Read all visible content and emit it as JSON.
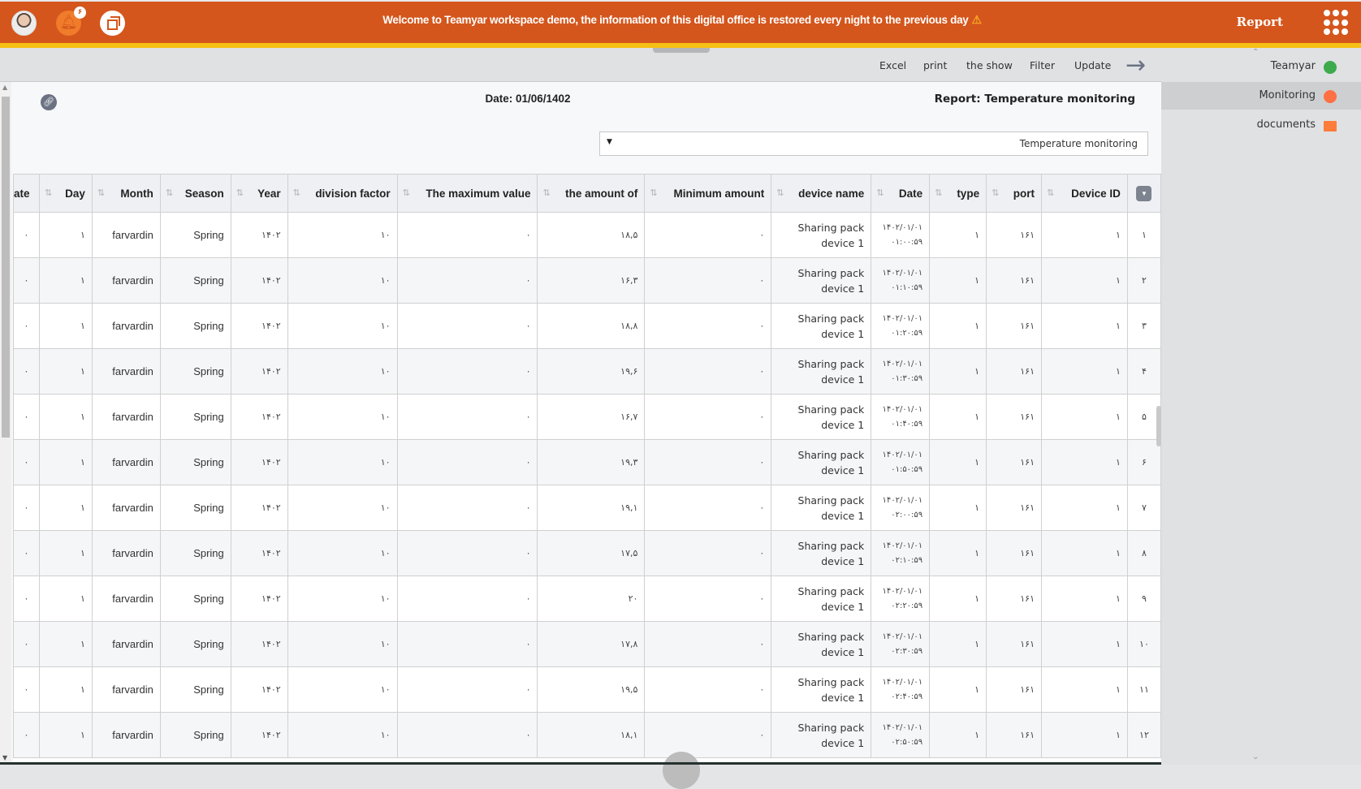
{
  "header": {
    "banner": "Welcome to Teamyar workspace demo, the information of this digital office is restored every night to the previous day",
    "notification_count": "۶",
    "title": "Report",
    "icons": [
      "avatar",
      "bell-icon",
      "window-icon",
      "warning-icon",
      "apps-grid-icon"
    ]
  },
  "toolbar": {
    "excel": "Excel",
    "print": "print",
    "show": "the show",
    "filter": "Filter",
    "update": "Update",
    "back_icon": "arrow-right-icon"
  },
  "report": {
    "date_label": "Date: 01/06/1402",
    "report_label": "Report: Temperature monitoring",
    "select_value": "Temperature monitoring"
  },
  "table": {
    "columns": [
      "ate",
      "Day",
      "Month",
      "Season",
      "Year",
      "division factor",
      "The maximum value",
      "the amount of",
      "Minimum amount",
      "device name",
      "Date",
      "type",
      "port",
      "Device ID"
    ],
    "rows": [
      {
        "rn": "۱",
        "ate": "۰",
        "day": "۱",
        "month": "farvardin",
        "season": "Spring",
        "year": "۱۴۰۲",
        "div": "۱۰",
        "max": "۰",
        "amount": "۱۸,۵",
        "min": "۰",
        "device": "Sharing pack device 1",
        "date1": "۱۴۰۲/۰۱/۰۱",
        "date2": "۰۱:۰۰:۵۹",
        "type": "۱",
        "port": "۱۶۱",
        "device_id": "۱"
      },
      {
        "rn": "۲",
        "ate": "۰",
        "day": "۱",
        "month": "farvardin",
        "season": "Spring",
        "year": "۱۴۰۲",
        "div": "۱۰",
        "max": "۰",
        "amount": "۱۶,۳",
        "min": "۰",
        "device": "Sharing pack device 1",
        "date1": "۱۴۰۲/۰۱/۰۱",
        "date2": "۰۱:۱۰:۵۹",
        "type": "۱",
        "port": "۱۶۱",
        "device_id": "۱"
      },
      {
        "rn": "۳",
        "ate": "۰",
        "day": "۱",
        "month": "farvardin",
        "season": "Spring",
        "year": "۱۴۰۲",
        "div": "۱۰",
        "max": "۰",
        "amount": "۱۸,۸",
        "min": "۰",
        "device": "Sharing pack device 1",
        "date1": "۱۴۰۲/۰۱/۰۱",
        "date2": "۰۱:۲۰:۵۹",
        "type": "۱",
        "port": "۱۶۱",
        "device_id": "۱"
      },
      {
        "rn": "۴",
        "ate": "۰",
        "day": "۱",
        "month": "farvardin",
        "season": "Spring",
        "year": "۱۴۰۲",
        "div": "۱۰",
        "max": "۰",
        "amount": "۱۹,۶",
        "min": "۰",
        "device": "Sharing pack device 1",
        "date1": "۱۴۰۲/۰۱/۰۱",
        "date2": "۰۱:۳۰:۵۹",
        "type": "۱",
        "port": "۱۶۱",
        "device_id": "۱"
      },
      {
        "rn": "۵",
        "ate": "۰",
        "day": "۱",
        "month": "farvardin",
        "season": "Spring",
        "year": "۱۴۰۲",
        "div": "۱۰",
        "max": "۰",
        "amount": "۱۶,۷",
        "min": "۰",
        "device": "Sharing pack device 1",
        "date1": "۱۴۰۲/۰۱/۰۱",
        "date2": "۰۱:۴۰:۵۹",
        "type": "۱",
        "port": "۱۶۱",
        "device_id": "۱"
      },
      {
        "rn": "۶",
        "ate": "۰",
        "day": "۱",
        "month": "farvardin",
        "season": "Spring",
        "year": "۱۴۰۲",
        "div": "۱۰",
        "max": "۰",
        "amount": "۱۹,۳",
        "min": "۰",
        "device": "Sharing pack device 1",
        "date1": "۱۴۰۲/۰۱/۰۱",
        "date2": "۰۱:۵۰:۵۹",
        "type": "۱",
        "port": "۱۶۱",
        "device_id": "۱"
      },
      {
        "rn": "۷",
        "ate": "۰",
        "day": "۱",
        "month": "farvardin",
        "season": "Spring",
        "year": "۱۴۰۲",
        "div": "۱۰",
        "max": "۰",
        "amount": "۱۹,۱",
        "min": "۰",
        "device": "Sharing pack device 1",
        "date1": "۱۴۰۲/۰۱/۰۱",
        "date2": "۰۲:۰۰:۵۹",
        "type": "۱",
        "port": "۱۶۱",
        "device_id": "۱"
      },
      {
        "rn": "۸",
        "ate": "۰",
        "day": "۱",
        "month": "farvardin",
        "season": "Spring",
        "year": "۱۴۰۲",
        "div": "۱۰",
        "max": "۰",
        "amount": "۱۷,۵",
        "min": "۰",
        "device": "Sharing pack device 1",
        "date1": "۱۴۰۲/۰۱/۰۱",
        "date2": "۰۲:۱۰:۵۹",
        "type": "۱",
        "port": "۱۶۱",
        "device_id": "۱"
      },
      {
        "rn": "۹",
        "ate": "۰",
        "day": "۱",
        "month": "farvardin",
        "season": "Spring",
        "year": "۱۴۰۲",
        "div": "۱۰",
        "max": "۰",
        "amount": "۲۰",
        "min": "۰",
        "device": "Sharing pack device 1",
        "date1": "۱۴۰۲/۰۱/۰۱",
        "date2": "۰۲:۲۰:۵۹",
        "type": "۱",
        "port": "۱۶۱",
        "device_id": "۱"
      },
      {
        "rn": "۱۰",
        "ate": "۰",
        "day": "۱",
        "month": "farvardin",
        "season": "Spring",
        "year": "۱۴۰۲",
        "div": "۱۰",
        "max": "۰",
        "amount": "۱۷,۸",
        "min": "۰",
        "device": "Sharing pack device 1",
        "date1": "۱۴۰۲/۰۱/۰۱",
        "date2": "۰۲:۳۰:۵۹",
        "type": "۱",
        "port": "۱۶۱",
        "device_id": "۱"
      },
      {
        "rn": "۱۱",
        "ate": "۰",
        "day": "۱",
        "month": "farvardin",
        "season": "Spring",
        "year": "۱۴۰۲",
        "div": "۱۰",
        "max": "۰",
        "amount": "۱۹,۵",
        "min": "۰",
        "device": "Sharing pack device 1",
        "date1": "۱۴۰۲/۰۱/۰۱",
        "date2": "۰۲:۴۰:۵۹",
        "type": "۱",
        "port": "۱۶۱",
        "device_id": "۱"
      },
      {
        "rn": "۱۲",
        "ate": "۰",
        "day": "۱",
        "month": "farvardin",
        "season": "Spring",
        "year": "۱۴۰۲",
        "div": "۱۰",
        "max": "۰",
        "amount": "۱۸,۱",
        "min": "۰",
        "device": "Sharing pack device 1",
        "date1": "۱۴۰۲/۰۱/۰۱",
        "date2": "۰۲:۵۰:۵۹",
        "type": "۱",
        "port": "۱۶۱",
        "device_id": "۱"
      }
    ]
  },
  "sidebar": {
    "items": [
      {
        "label": "Teamyar",
        "icon": "database-icon",
        "active": false
      },
      {
        "label": "Monitoring",
        "icon": "chart-icon",
        "active": true
      },
      {
        "label": "documents",
        "icon": "folder-icon",
        "active": false
      }
    ]
  },
  "colors": {
    "header": "#d4561c",
    "stripe": "#f6c015",
    "toolbar": "#dfe1e3",
    "teamyar_icon": "#3daa4b",
    "monitoring_icon": "#ff7043",
    "documents_icon": "#ff7c3a"
  }
}
